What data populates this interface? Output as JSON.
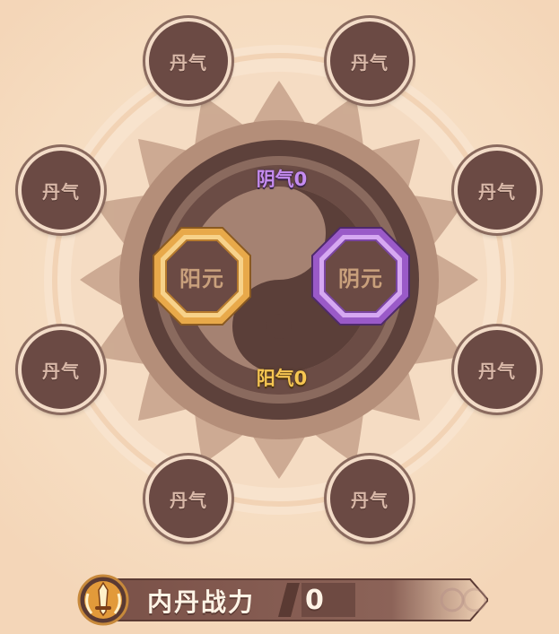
{
  "slots": [
    {
      "label": "丹气"
    },
    {
      "label": "丹气"
    },
    {
      "label": "丹气"
    },
    {
      "label": "丹气"
    },
    {
      "label": "丹气"
    },
    {
      "label": "丹气"
    },
    {
      "label": "丹气"
    },
    {
      "label": "丹气"
    }
  ],
  "core": {
    "yang_label": "阳元",
    "yin_label": "阴元",
    "yin_qi": "阴气0",
    "yang_qi": "阳气0"
  },
  "power": {
    "title": "内丹战力",
    "value": "0"
  },
  "colors": {
    "yin_accent": "#b77ee0",
    "yang_accent": "#f3c05a",
    "slot_bg": "#6b4a44"
  },
  "icons": {
    "emblem": "sword-shield-emblem-icon",
    "taiji": "yin-yang-icon"
  }
}
